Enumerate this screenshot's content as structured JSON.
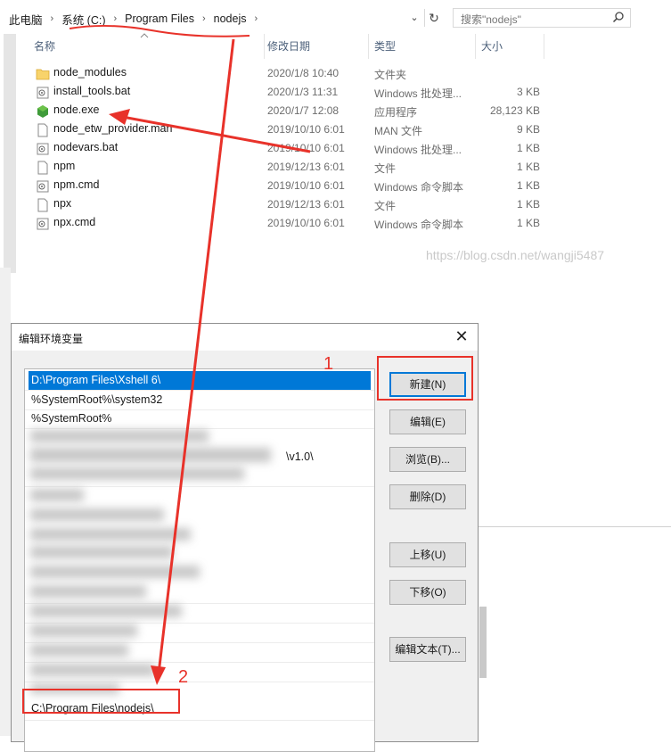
{
  "explorer": {
    "breadcrumbs": [
      "此电脑",
      "系统 (C:)",
      "Program Files",
      "nodejs"
    ],
    "search_placeholder": "搜索\"nodejs\"",
    "columns": {
      "name": "名称",
      "date": "修改日期",
      "type": "类型",
      "size": "大小"
    },
    "files": [
      {
        "name": "node_modules",
        "date": "2020/1/8 10:40",
        "type": "文件夹",
        "size": "",
        "icon": "folder-icon"
      },
      {
        "name": "install_tools.bat",
        "date": "2020/1/3 11:31",
        "type": "Windows 批处理...",
        "size": "3 KB",
        "icon": "batch-file-icon"
      },
      {
        "name": "node.exe",
        "date": "2020/1/7 12:08",
        "type": "应用程序",
        "size": "28,123 KB",
        "icon": "node-exe-icon"
      },
      {
        "name": "node_etw_provider.man",
        "date": "2019/10/10 6:01",
        "type": "MAN 文件",
        "size": "9 KB",
        "icon": "file-icon"
      },
      {
        "name": "nodevars.bat",
        "date": "2019/10/10 6:01",
        "type": "Windows 批处理...",
        "size": "1 KB",
        "icon": "batch-file-icon"
      },
      {
        "name": "npm",
        "date": "2019/12/13 6:01",
        "type": "文件",
        "size": "1 KB",
        "icon": "file-icon"
      },
      {
        "name": "npm.cmd",
        "date": "2019/10/10 6:01",
        "type": "Windows 命令脚本",
        "size": "1 KB",
        "icon": "batch-file-icon"
      },
      {
        "name": "npx",
        "date": "2019/12/13 6:01",
        "type": "文件",
        "size": "1 KB",
        "icon": "file-icon"
      },
      {
        "name": "npx.cmd",
        "date": "2019/10/10 6:01",
        "type": "Windows 命令脚本",
        "size": "1 KB",
        "icon": "batch-file-icon"
      }
    ]
  },
  "watermark": "https://blog.csdn.net/wangji5487",
  "dialog": {
    "title": "编辑环境变量",
    "close_glyph": "✕",
    "entries": [
      "D:\\Program Files\\Xshell 6\\",
      "%SystemRoot%\\system32",
      "%SystemRoot%",
      "\\v1.0\\",
      "C:\\Program Files\\nodejs\\"
    ],
    "buttons": {
      "new": "新建(N)",
      "edit": "编辑(E)",
      "browse": "浏览(B)...",
      "delete": "删除(D)",
      "move_up": "上移(U)",
      "move_down": "下移(O)",
      "edit_text": "编辑文本(T)..."
    }
  },
  "annotations": {
    "label_1": "1",
    "label_2": "2",
    "color": "#e8322a"
  },
  "colors": {
    "selection": "#0078d7",
    "header_text": "#4c607a",
    "annotation": "#e8322a"
  }
}
